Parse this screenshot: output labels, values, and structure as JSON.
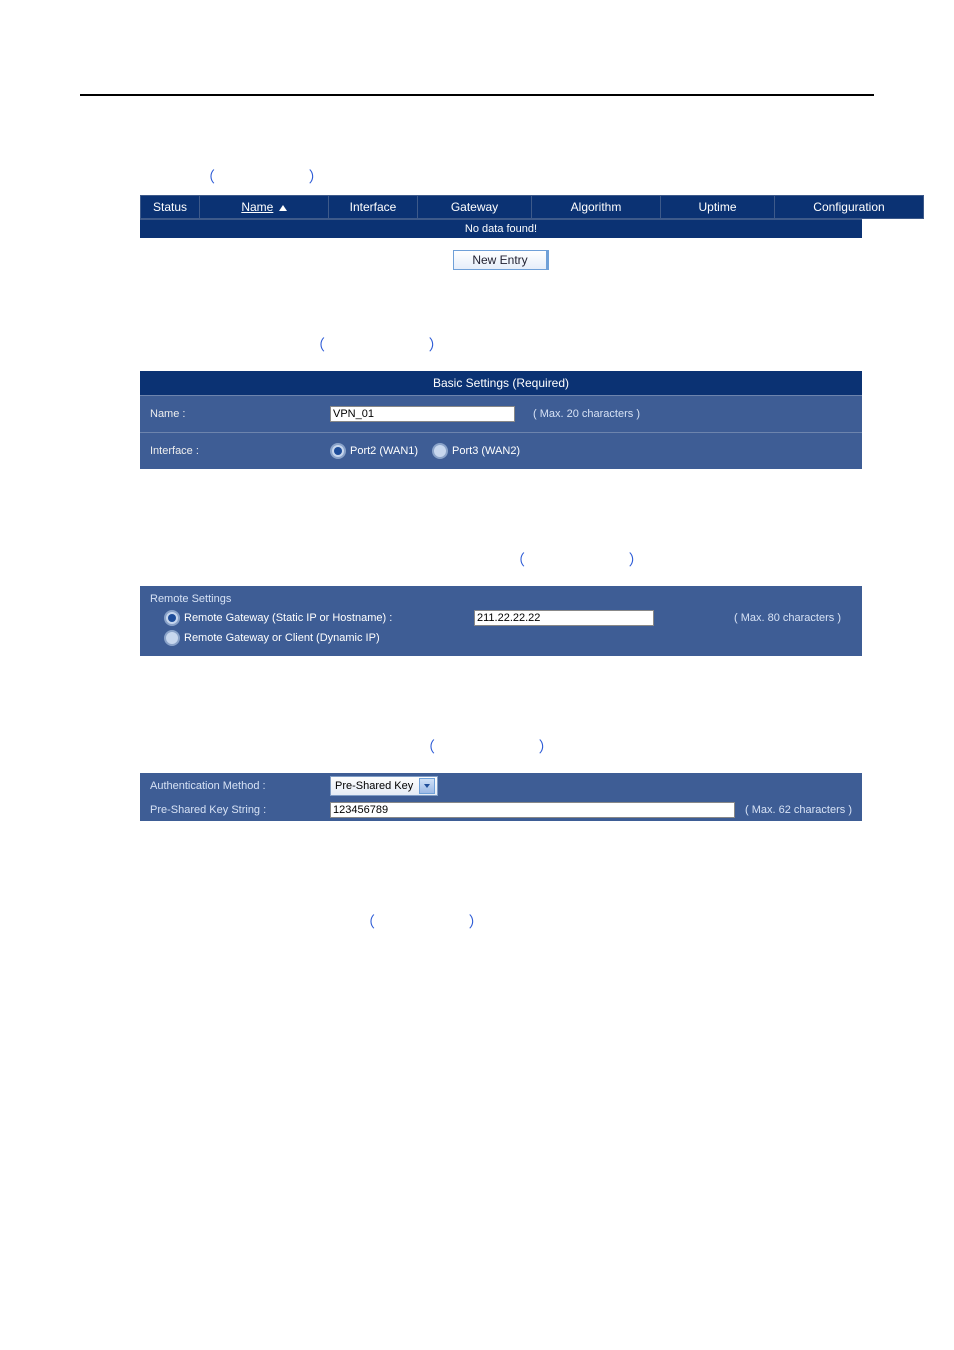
{
  "table_header": {
    "status": "Status",
    "name": "Name",
    "interface": "Interface",
    "gateway": "Gateway",
    "algorithm": "Algorithm",
    "uptime": "Uptime",
    "configuration": "Configuration"
  },
  "no_data": "No data found!",
  "new_entry": "New Entry",
  "basic": {
    "panel_title": "Basic Settings (Required)",
    "name_label": "Name :",
    "name_value": "VPN_01",
    "name_hint": "( Max. 20 characters )",
    "interface_label": "Interface :",
    "opt1": "Port2 (WAN1)",
    "opt2": "Port3 (WAN2)"
  },
  "remote": {
    "heading": "Remote Settings",
    "opt1_label": "Remote Gateway (Static IP or Hostname) :",
    "opt2_label": "Remote Gateway or Client (Dynamic IP)",
    "value": "211.22.22.22",
    "hint": "( Max. 80 characters )"
  },
  "auth": {
    "method_label": "Authentication Method :",
    "method_value": "Pre-Shared Key",
    "psk_label": "Pre-Shared Key String :",
    "psk_value": "123456789",
    "psk_hint": "( Max. 62 characters )"
  },
  "parens": {
    "left": "（",
    "right": "）"
  }
}
